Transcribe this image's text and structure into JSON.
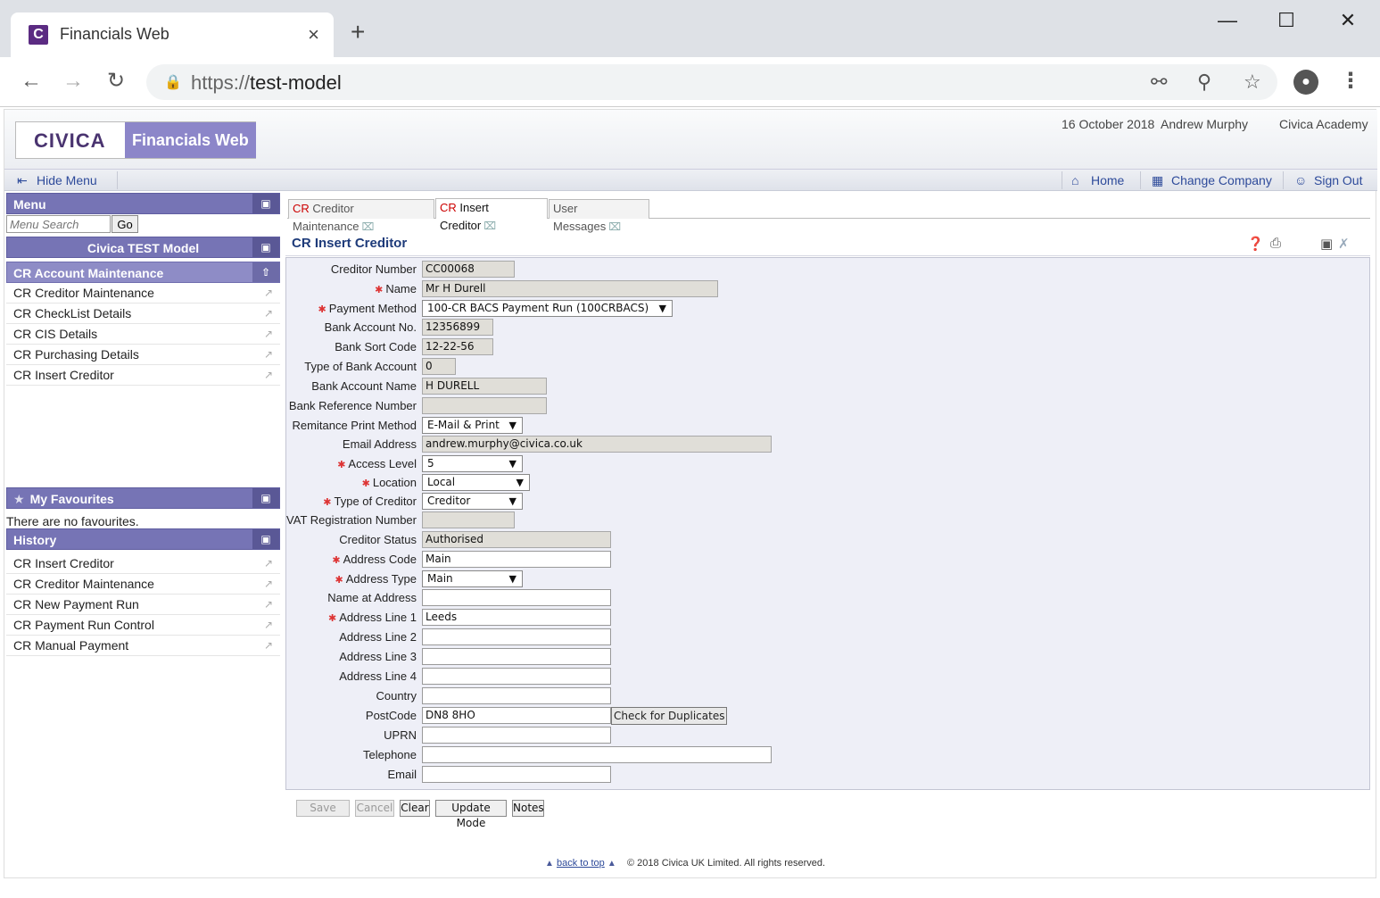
{
  "browser": {
    "tab_title": "Financials Web",
    "tab_close": "×",
    "new_tab": "+",
    "url_scheme": "https://",
    "url_host": "test-model",
    "icons": [
      "back-icon",
      "forward-icon",
      "reload-icon",
      "lock-icon",
      "key-icon",
      "zoom-out-icon",
      "star-icon",
      "profile-icon",
      "menu-icon"
    ]
  },
  "header": {
    "logo_text": "CIVICA",
    "product_name": "Financials Web",
    "date": "16 October 2018",
    "user": "Andrew Murphy",
    "company": "Civica Academy"
  },
  "menubar": {
    "hide_menu": "Hide Menu",
    "home": "Home",
    "change_company": "Change Company",
    "sign_out": "Sign Out"
  },
  "sidebar": {
    "menu_title": "Menu",
    "search_placeholder": "Menu Search",
    "go_label": "Go",
    "model_title": "Civica TEST Model",
    "group_title": "CR Account Maintenance",
    "items": [
      {
        "label": "CR Creditor Maintenance"
      },
      {
        "label": "CR CheckList Details"
      },
      {
        "label": "CR CIS Details"
      },
      {
        "label": "CR Purchasing Details"
      },
      {
        "label": "CR Insert Creditor"
      }
    ],
    "favourites_title": "My Favourites",
    "no_favourites": "There are no favourites.",
    "history_title": "History",
    "history": [
      {
        "label": "CR Insert Creditor"
      },
      {
        "label": "CR Creditor Maintenance"
      },
      {
        "label": "CR New Payment Run"
      },
      {
        "label": "CR Payment Run Control"
      },
      {
        "label": "CR Manual Payment"
      }
    ]
  },
  "content_tabs": [
    {
      "prefix": "CR",
      "label": "Creditor Maintenance",
      "active": false
    },
    {
      "prefix": "CR",
      "label": "Insert Creditor",
      "active": true
    },
    {
      "prefix": "",
      "label": "User Messages",
      "active": false
    }
  ],
  "form": {
    "title": "CR Insert Creditor",
    "fields": {
      "creditor_number": {
        "label": "Creditor Number",
        "value": "CC00068"
      },
      "name": {
        "label": "Name",
        "value": "Mr H Durell"
      },
      "payment_method": {
        "label": "Payment Method",
        "value": "100-CR BACS Payment Run (100CRBACS)"
      },
      "bank_account_no": {
        "label": "Bank Account No.",
        "value": "12356899"
      },
      "bank_sort_code": {
        "label": "Bank Sort Code",
        "value": "12-22-56"
      },
      "type_of_bank_account": {
        "label": "Type of Bank Account",
        "value": "0"
      },
      "bank_account_name": {
        "label": "Bank Account Name",
        "value": "H DURELL"
      },
      "bank_reference_number": {
        "label": "Bank Reference Number",
        "value": ""
      },
      "remittance_print_method": {
        "label": "Remitance Print Method",
        "value": "E-Mail & Print"
      },
      "email_address": {
        "label": "Email Address",
        "value": "andrew.murphy@civica.co.uk"
      },
      "access_level": {
        "label": "Access Level",
        "value": "5"
      },
      "location": {
        "label": "Location",
        "value": "Local"
      },
      "type_of_creditor": {
        "label": "Type of Creditor",
        "value": "Creditor"
      },
      "vat_registration_number": {
        "label": "VAT Registration Number",
        "value": ""
      },
      "creditor_status": {
        "label": "Creditor Status",
        "value": "Authorised"
      },
      "address_code": {
        "label": "Address Code",
        "value": "Main"
      },
      "address_type": {
        "label": "Address Type",
        "value": "Main"
      },
      "name_at_address": {
        "label": "Name at Address",
        "value": ""
      },
      "address_line_1": {
        "label": "Address Line 1",
        "value": "Leeds"
      },
      "address_line_2": {
        "label": "Address Line 2",
        "value": ""
      },
      "address_line_3": {
        "label": "Address Line 3",
        "value": ""
      },
      "address_line_4": {
        "label": "Address Line 4",
        "value": ""
      },
      "country": {
        "label": "Country",
        "value": ""
      },
      "postcode": {
        "label": "PostCode",
        "value": "DN8 8HO"
      },
      "uprn": {
        "label": "UPRN",
        "value": ""
      },
      "telephone": {
        "label": "Telephone",
        "value": ""
      },
      "email": {
        "label": "Email",
        "value": ""
      }
    },
    "check_duplicates": "Check for Duplicates",
    "buttons": {
      "save": "Save",
      "cancel": "Cancel",
      "clear": "Clear",
      "update_mode": "Update Mode",
      "notes": "Notes"
    }
  },
  "footer": {
    "back_to_top": "back to top",
    "copyright": "© 2018 Civica UK Limited. All rights reserved."
  }
}
